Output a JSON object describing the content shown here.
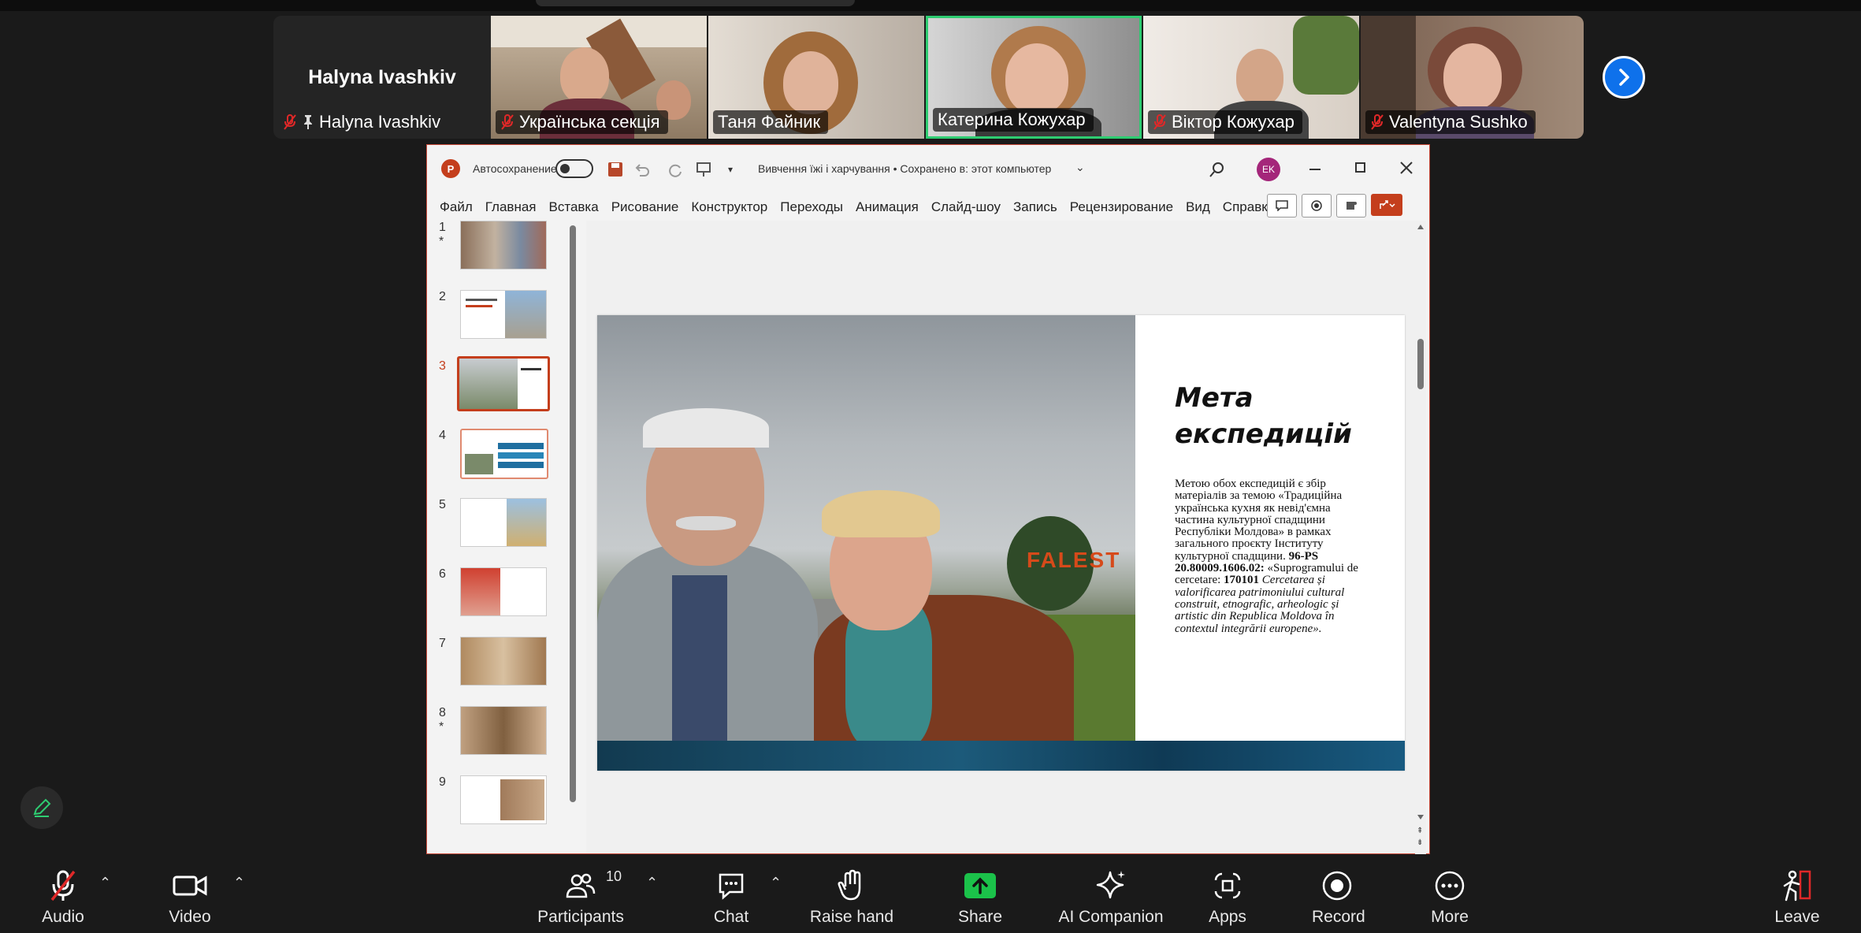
{
  "participants": {
    "active_speaker_name": "Halyna Ivashkiv",
    "tiles": [
      {
        "label": "Halyna Ivashkiv"
      },
      {
        "label": "Українська секція"
      },
      {
        "label": "Таня Файник"
      },
      {
        "label": "Катерина Кожухар"
      },
      {
        "label": "Віктор Кожухар"
      },
      {
        "label": "Valentyna Sushko"
      }
    ]
  },
  "ppt": {
    "autosave_label": "Автосохранение",
    "doc_title": "Вивчення їжі і харчування • Сохранено в: этот компьютер",
    "avatar_initials": "EK",
    "menu": [
      "Файл",
      "Главная",
      "Вставка",
      "Рисование",
      "Конструктор",
      "Переходы",
      "Анимация",
      "Слайд-шоу",
      "Запись",
      "Рецензирование",
      "Вид",
      "Справка"
    ],
    "thumbnails": [
      {
        "num": "1",
        "star": "*"
      },
      {
        "num": "2",
        "star": ""
      },
      {
        "num": "3",
        "star": ""
      },
      {
        "num": "4",
        "star": ""
      },
      {
        "num": "5",
        "star": ""
      },
      {
        "num": "6",
        "star": ""
      },
      {
        "num": "7",
        "star": ""
      },
      {
        "num": "8",
        "star": "*"
      },
      {
        "num": "9",
        "star": ""
      }
    ],
    "selected_slide": 3,
    "slide": {
      "title_line1": "Мета",
      "title_line2": "експедицій",
      "sign_text": "FALEST",
      "body_p1": "Метою обох експедицій є збір матеріалів за темою «Традиційна українська кухня як невід'ємна частина культурної спадщини Республіки Молдова» в рамках загального проєкту Інституту культурної спадщини.",
      "body_code": "96-PS 20.80009.1606.02:",
      "body_p2": "«Suprogramului de cercetare:",
      "body_code2": "170101",
      "body_italic": "Cercetarea și valorificarea patrimoniului cultural construit, etnografic, arheologic și artistic din Republica Moldova în contextul integrării europene»."
    }
  },
  "toolbar": {
    "audio": "Audio",
    "video": "Video",
    "participants": "Participants",
    "participants_count": "10",
    "chat": "Chat",
    "raise_hand": "Raise hand",
    "share": "Share",
    "ai_companion": "AI Companion",
    "apps": "Apps",
    "record": "Record",
    "more": "More",
    "leave": "Leave"
  },
  "colors": {
    "accent_blue": "#0e71eb",
    "share_green": "#1bc24a",
    "active_border": "#2ecc71",
    "muted_red": "#e02828",
    "ppt_red": "#c43e1c"
  }
}
